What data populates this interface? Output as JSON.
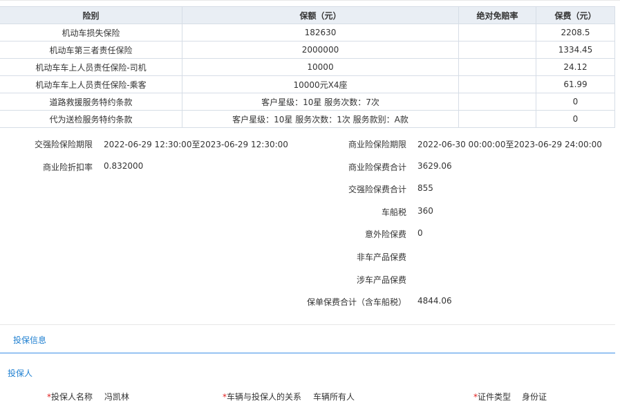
{
  "table": {
    "headers": [
      "险别",
      "保额（元）",
      "绝对免赔率",
      "保费（元）"
    ],
    "rows": [
      {
        "name": "机动车损失保险",
        "amount": "182630",
        "deductible": "",
        "premium": "2208.5"
      },
      {
        "name": "机动车第三者责任保险",
        "amount": "2000000",
        "deductible": "",
        "premium": "1334.45"
      },
      {
        "name": "机动车车上人员责任保险-司机",
        "amount": "10000",
        "deductible": "",
        "premium": "24.12"
      },
      {
        "name": "机动车车上人员责任保险-乘客",
        "amount": "10000元X4座",
        "deductible": "",
        "premium": "61.99"
      },
      {
        "name": "道路救援服务特约条款",
        "amount": "客户星级：10星 服务次数：7次",
        "deductible": "",
        "premium": "0"
      },
      {
        "name": "代为送检服务特约条款",
        "amount": "客户星级：10星 服务次数：1次 服务款别：A款",
        "deductible": "",
        "premium": "0"
      }
    ]
  },
  "left_info": {
    "jq_period_label": "交强险保险期限",
    "jq_period_value": "2022-06-29 12:30:00至2023-06-29 12:30:00",
    "discount_label": "商业险折扣率",
    "discount_value": "0.832000"
  },
  "right_info": {
    "items": [
      {
        "label": "商业险保险期限",
        "value": "2022-06-30 00:00:00至2023-06-29 24:00:00"
      },
      {
        "label": "商业险保费合计",
        "value": "3629.06"
      },
      {
        "label": "交强险保费合计",
        "value": "855"
      },
      {
        "label": "车船税",
        "value": "360"
      },
      {
        "label": "意外险保费",
        "value": "0"
      },
      {
        "label": "非车产品保费",
        "value": ""
      },
      {
        "label": "涉车产品保费",
        "value": ""
      },
      {
        "label": "保单保费合计（含车船税）",
        "value": "4844.06"
      }
    ]
  },
  "section": {
    "tab_label": "投保信息",
    "subsection_title": "投保人",
    "asterisk": "*",
    "fields": [
      {
        "label": "投保人名称",
        "value": "冯凯林"
      },
      {
        "label": "车辆与投保人的关系",
        "value": "车辆所有人"
      },
      {
        "label": "证件类型",
        "value": "身份证"
      }
    ]
  }
}
